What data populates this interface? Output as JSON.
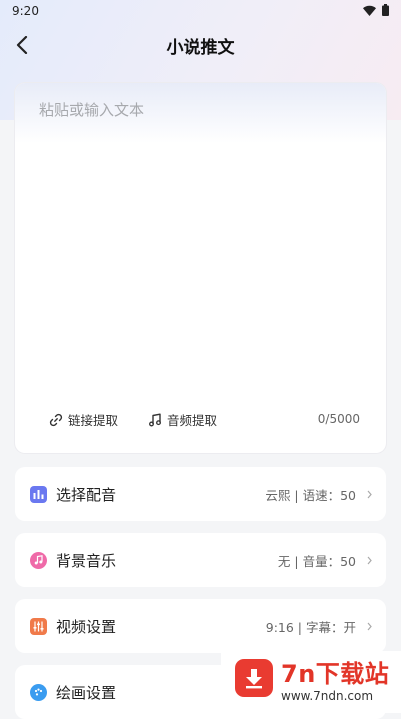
{
  "status": {
    "time": "9:20"
  },
  "header": {
    "title": "小说推文"
  },
  "editor": {
    "placeholder": "粘贴或输入文本",
    "value": "",
    "link_extract": "链接提取",
    "audio_extract": "音频提取",
    "counter": "0/5000"
  },
  "settings": [
    {
      "label": "选择配音",
      "value": "云熙 | 语速：50",
      "icon": "bar-chart-icon",
      "color": "#6a78f0"
    },
    {
      "label": "背景音乐",
      "value": "无 | 音量：50",
      "icon": "music-note-icon",
      "color": "#ef6aa8"
    },
    {
      "label": "视频设置",
      "value": "9:16 | 字幕：开",
      "icon": "equalizer-icon",
      "color": "#f07a4a"
    },
    {
      "label": "绘画设置",
      "value": "",
      "icon": "palette-icon",
      "color": "#3a9cf0"
    }
  ],
  "watermark": {
    "brand": "7n下载站",
    "url": "www.7ndn.com"
  }
}
